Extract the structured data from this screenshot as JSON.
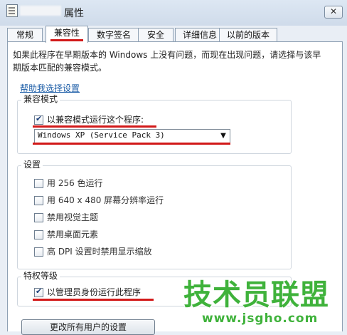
{
  "window": {
    "title": "属性",
    "close_label": "✕"
  },
  "tabs": [
    {
      "label": "常规"
    },
    {
      "label": "兼容性"
    },
    {
      "label": "数字签名"
    },
    {
      "label": "安全"
    },
    {
      "label": "详细信息"
    },
    {
      "label": "以前的版本"
    }
  ],
  "intro": {
    "text": "如果此程序在早期版本的 Windows 上没有问题，而现在出现问题，请选择与该早期版本匹配的兼容模式。"
  },
  "help_link": "帮助我选择设置",
  "compat_mode": {
    "group_label": "兼容模式",
    "checkbox_label": "以兼容模式运行这个程序:",
    "checked": true,
    "selected_os": "Windows XP (Service Pack 3)"
  },
  "settings": {
    "group_label": "设置",
    "options": [
      {
        "label": "用 256 色运行",
        "checked": false
      },
      {
        "label": "用 640 x 480 屏幕分辨率运行",
        "checked": false
      },
      {
        "label": "禁用视觉主题",
        "checked": false
      },
      {
        "label": "禁用桌面元素",
        "checked": false
      },
      {
        "label": "高 DPI 设置时禁用显示缩放",
        "checked": false
      }
    ]
  },
  "privilege": {
    "group_label": "特权等级",
    "checkbox_label": "以管理员身份运行此程序",
    "checked": true
  },
  "bottom_button": "更改所有用户的设置",
  "watermark": {
    "main": "技术员联盟",
    "url": "www.jsgho.com"
  },
  "colors": {
    "highlight": "#d21919",
    "link": "#1f5fa8",
    "watermark": "#3fb23b"
  }
}
